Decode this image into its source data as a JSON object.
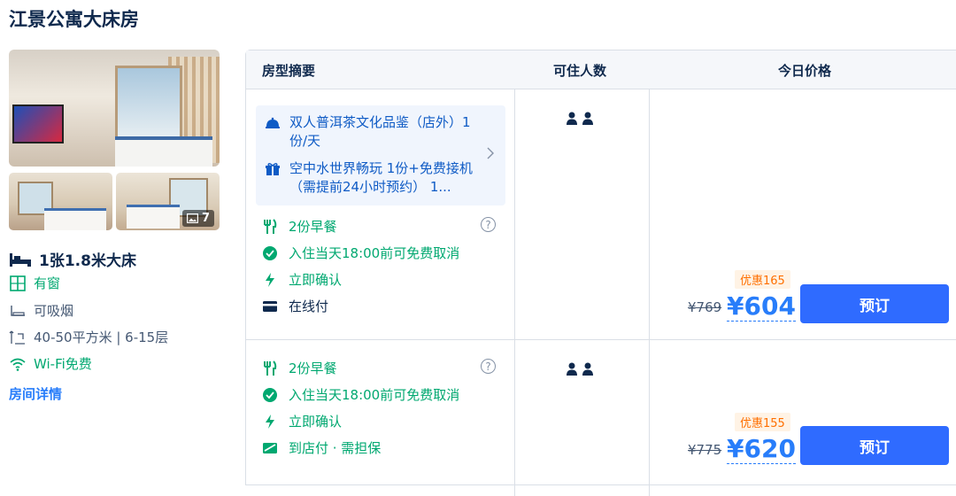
{
  "room": {
    "title": "江景公寓大床房",
    "photo_count": "7",
    "bed": "1张1.8米大床",
    "window": "有窗",
    "smoking": "可吸烟",
    "area": "40-50平方米 | 6-15层",
    "wifi": "Wi-Fi免费",
    "detail_link": "房间详情"
  },
  "table": {
    "headers": {
      "summary": "房型摘要",
      "guests": "可住人数",
      "price": "今日价格"
    },
    "rows": [
      {
        "promos": [
          {
            "icon": "cloche-icon",
            "text": "双人普洱茶文化品鉴（店外）1份/天"
          },
          {
            "icon": "gift-icon",
            "text": "空中水世界畅玩 1份+免费接机（需提前24小时预约） 1..."
          }
        ],
        "breakfast": "2份早餐",
        "cancel": "入住当天18:00前可免费取消",
        "confirm": "立即确认",
        "payment": "在线付",
        "discount": "优惠165",
        "original_price": "¥769",
        "price": "¥604",
        "book": "预订"
      },
      {
        "breakfast": "2份早餐",
        "cancel": "入住当天18:00前可免费取消",
        "confirm": "立即确认",
        "payment": "到店付 · 需担保",
        "discount": "优惠155",
        "original_price": "¥775",
        "price": "¥620",
        "book": "预订"
      }
    ]
  },
  "colors": {
    "green": "#00a870",
    "blue": "#287dfa",
    "orange": "#ff6f00",
    "button": "#2f6bff"
  }
}
